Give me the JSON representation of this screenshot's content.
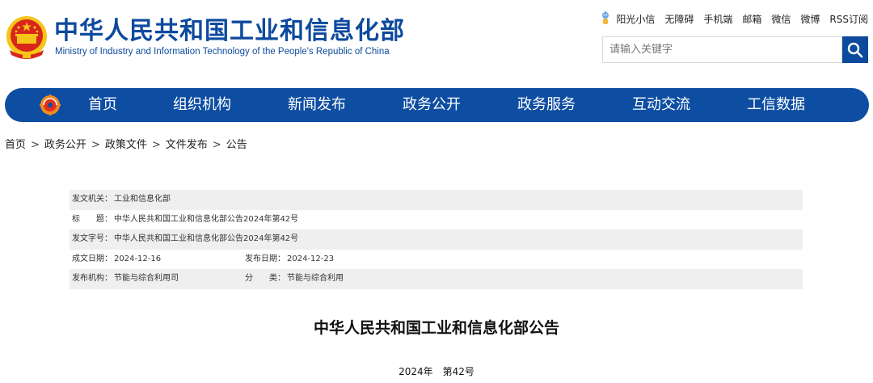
{
  "header": {
    "title": "中华人民共和国工业和信息化部",
    "subtitle": "Ministry of Industry and Information Technology of the People's Republic of China",
    "top_links": [
      "阳光小信",
      "无障碍",
      "手机端",
      "邮箱",
      "微信",
      "微博",
      "RSS订阅"
    ],
    "search": {
      "placeholder": "请输入关键字",
      "icon": "search-icon"
    },
    "colors": {
      "brand_blue": "#0d4a9e",
      "emblem_red": "#d8261c",
      "emblem_gold": "#f5c518"
    }
  },
  "nav": {
    "items": [
      "首页",
      "组织机构",
      "新闻发布",
      "政务公开",
      "政务服务",
      "互动交流",
      "工信数据"
    ]
  },
  "breadcrumb": [
    "首页",
    "政务公开",
    "政策文件",
    "文件发布",
    "公告"
  ],
  "breadcrumb_separator": ">",
  "info": {
    "issuer_label": "发文机关：",
    "issuer": "工业和信息化部",
    "title_label": "标　　题：",
    "title": "中华人民共和国工业和信息化部公告2024年第42号",
    "doc_no_label": "发文字号：",
    "doc_no": "中华人民共和国工业和信息化部公告2024年第42号",
    "written_date_label": "成文日期：",
    "written_date": "2024-12-16",
    "publish_date_label": "发布日期：",
    "publish_date": "2024-12-23",
    "agency_label": "发布机构：",
    "agency": "节能与综合利用司",
    "category_label": "分　　类：",
    "category": "节能与综合利用"
  },
  "document": {
    "heading": "中华人民共和国工业和信息化部公告",
    "number_line": "2024年　第42号"
  }
}
